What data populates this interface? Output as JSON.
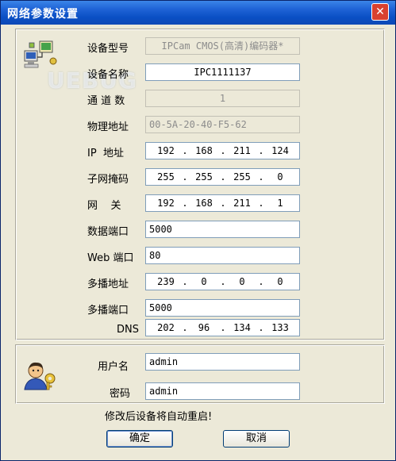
{
  "window": {
    "title": "网络参数设置"
  },
  "network": {
    "device_model": {
      "label": "设备型号",
      "value": "IPCam CMOS(高清)编码器*"
    },
    "device_name": {
      "label": "设备名称",
      "value": "IPC1111137"
    },
    "channel_count": {
      "label": "通 道 数",
      "value": "1"
    },
    "physical_address": {
      "label": "物理地址",
      "value": "00-5A-20-40-F5-62"
    },
    "ip_address": {
      "label": "IP  地址",
      "octets": [
        "192",
        "168",
        "211",
        "124"
      ]
    },
    "subnet_mask": {
      "label": "子网掩码",
      "octets": [
        "255",
        "255",
        "255",
        "0"
      ]
    },
    "gateway": {
      "label": "网    关",
      "octets": [
        "192",
        "168",
        "211",
        "1"
      ]
    },
    "data_port": {
      "label": "数据端口",
      "value": "5000"
    },
    "web_port": {
      "label": "Web 端口",
      "value": "80"
    },
    "multicast_address": {
      "label": "多播地址",
      "octets": [
        "239",
        "0",
        "0",
        "0"
      ]
    },
    "multicast_port": {
      "label": "多播端口",
      "value": "5000"
    },
    "dns": {
      "label": "DNS",
      "octets": [
        "202",
        "96",
        "134",
        "133"
      ]
    }
  },
  "account": {
    "username": {
      "label": "用户名",
      "value": "admin"
    },
    "password": {
      "label": "密码",
      "value": "admin"
    }
  },
  "notice": "修改后设备将自动重启!",
  "buttons": {
    "ok": "确定",
    "cancel": "取消"
  },
  "watermark": "UEBUG",
  "icons": {
    "network": "network-computer-icon",
    "user": "user-key-icon",
    "close": "close-icon"
  }
}
